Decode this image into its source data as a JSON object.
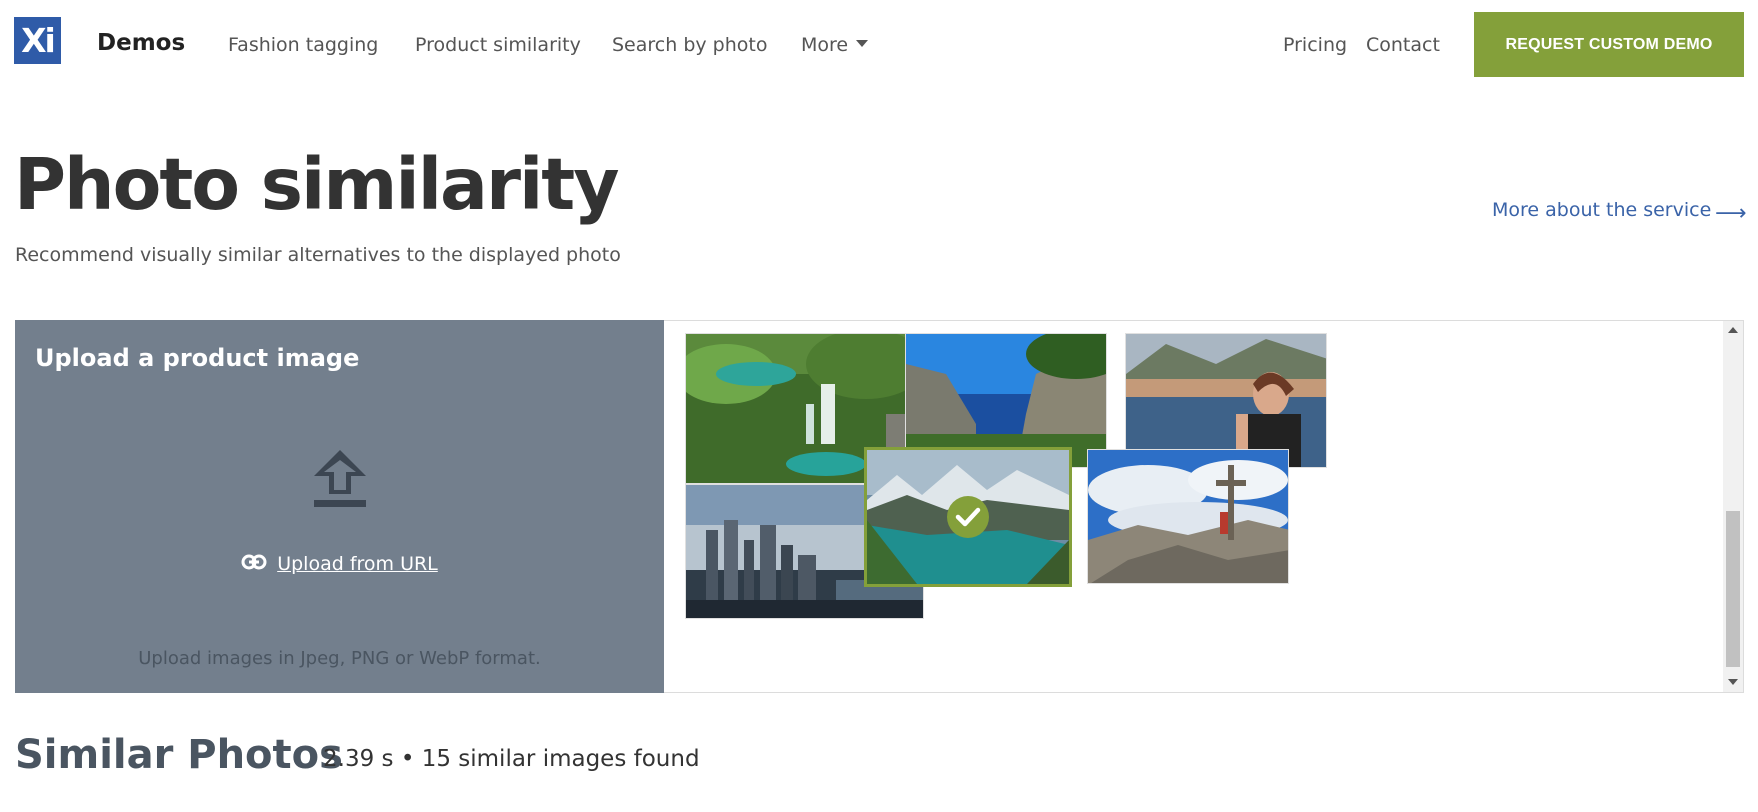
{
  "header": {
    "logo_text": "Xi",
    "brand": "Demos",
    "nav": {
      "fashion": "Fashion tagging",
      "product": "Product similarity",
      "search": "Search by photo",
      "more": "More",
      "pricing": "Pricing",
      "contact": "Contact"
    },
    "cta": "REQUEST CUSTOM DEMO"
  },
  "page": {
    "title": "Photo similarity",
    "subtitle": "Recommend visually similar alternatives to the displayed photo",
    "more_link": "More about the service",
    "more_arrow": "⟶"
  },
  "upload": {
    "title": "Upload a product image",
    "url_label": "Upload from URL",
    "hint": "Upload images in Jpeg, PNG or WebP format."
  },
  "gallery": {
    "selected_index": 4,
    "thumbs": [
      "waterfall-lakes",
      "sea-cliffs",
      "woman-by-lake",
      "city-skyline",
      "mountain-lake",
      "summit-cross"
    ]
  },
  "results": {
    "title": "Similar Photos",
    "meta": "2.39 s • 15 similar images found"
  },
  "colors": {
    "brand_blue": "#2f5ba8",
    "accent_green": "#84a03a",
    "upload_panel": "#737f8d",
    "link_blue": "#3a63a8"
  }
}
